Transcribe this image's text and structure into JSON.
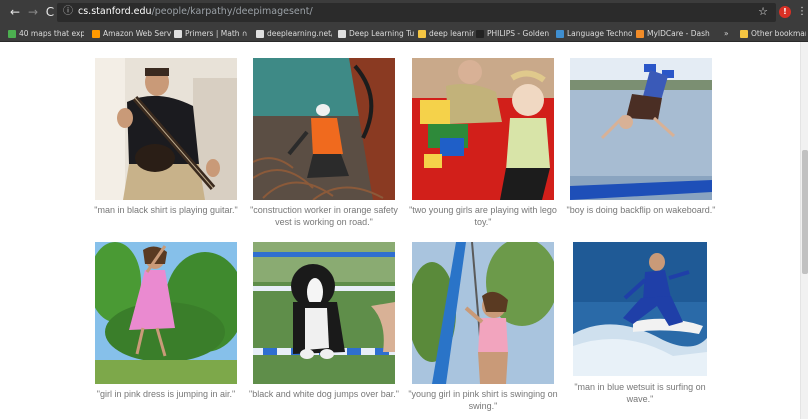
{
  "browser": {
    "url_host": "cs.stanford.edu",
    "url_path": "/people/karpathy/deepimagesent/",
    "bookmarks": [
      {
        "label": "40 maps that explain",
        "color": "#4caf50"
      },
      {
        "label": "Amazon Web Services",
        "color": "#ff9900"
      },
      {
        "label": "Primers | Math ∩ Pro",
        "color": "#e0e0e0"
      },
      {
        "label": "deeplearning.net/tuto",
        "color": "#e0e0e0"
      },
      {
        "label": "Deep Learning Tutori",
        "color": "#e0e0e0"
      },
      {
        "label": "deep learning",
        "color": "#f4c542"
      },
      {
        "label": "PHILIPS - Golden Ears",
        "color": "#222222"
      },
      {
        "label": "Language Technologie",
        "color": "#3f8fd1"
      },
      {
        "label": "MyIDCare - Dashboa",
        "color": "#f28c28"
      },
      {
        "label": "»",
        "color": ""
      },
      {
        "label": "Other bookmarks",
        "color": "#f4c542"
      }
    ]
  },
  "gallery": [
    {
      "caption": "\"man in black shirt is playing guitar.\""
    },
    {
      "caption": "\"construction worker in orange safety vest is working on road.\""
    },
    {
      "caption": "\"two young girls are playing with lego toy.\""
    },
    {
      "caption": "\"boy is doing backflip on wakeboard.\""
    },
    {
      "caption": "\"girl in pink dress is jumping in air.\""
    },
    {
      "caption": "\"black and white dog jumps over bar.\""
    },
    {
      "caption": "\"young girl in pink shirt is swinging on swing.\""
    },
    {
      "caption": "\"man in blue wetsuit is surfing on wave.\""
    }
  ]
}
